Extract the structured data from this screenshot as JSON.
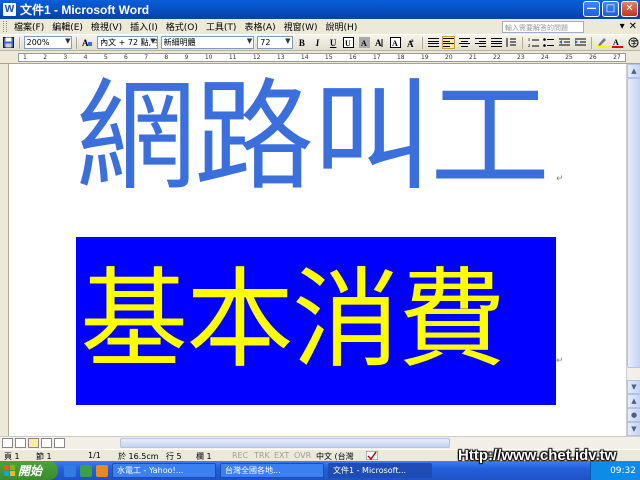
{
  "window": {
    "title": "文件1 - Microsoft Word"
  },
  "window_controls": {
    "minimize": "—",
    "maximize": "□",
    "close": "✕"
  },
  "menubar": {
    "items": [
      "檔案(F)",
      "編輯(E)",
      "檢視(V)",
      "插入(I)",
      "格式(O)",
      "工具(T)",
      "表格(A)",
      "視窗(W)",
      "說明(H)"
    ],
    "help_placeholder": "輸入需要解答的問題",
    "doc_controls": [
      "▾",
      "✕"
    ]
  },
  "toolbar": {
    "zoom": "200%",
    "style": "內文 + 72 點, 字",
    "font": "新細明體",
    "size": "72",
    "bold": "B",
    "italic": "I",
    "underline": "U"
  },
  "ruler": {
    "ticks": [
      "1",
      "2",
      "3",
      "4",
      "5",
      "6",
      "7",
      "8",
      "9",
      "10",
      "11",
      "12",
      "13",
      "14",
      "15",
      "16",
      "17",
      "18",
      "19",
      "20",
      "21",
      "22",
      "23",
      "24",
      "25",
      "26",
      "27"
    ]
  },
  "document": {
    "headline": "網路叫工",
    "banner": "基本消費",
    "para_mark": "↵"
  },
  "colors": {
    "headline": "#3b6fdc",
    "banner_bg": "#0000ff",
    "banner_text": "#ffff00"
  },
  "statusbar": {
    "page": "頁 1",
    "section": "節 1",
    "pages": "1/1",
    "position": "於 16.5cm",
    "line": "行 5",
    "column": "欄 1",
    "rec": "REC",
    "trk": "TRK",
    "ext": "EXT",
    "ovr": "OVR",
    "language": "中文 (台灣"
  },
  "taskbar": {
    "start": "開始",
    "items": [
      "水電工 - Yahoo!...",
      "台灣全國各地...",
      "文件1 - Microsoft..."
    ],
    "clock": "09:32"
  },
  "watermark": "Http://www.chet.idv.tw"
}
